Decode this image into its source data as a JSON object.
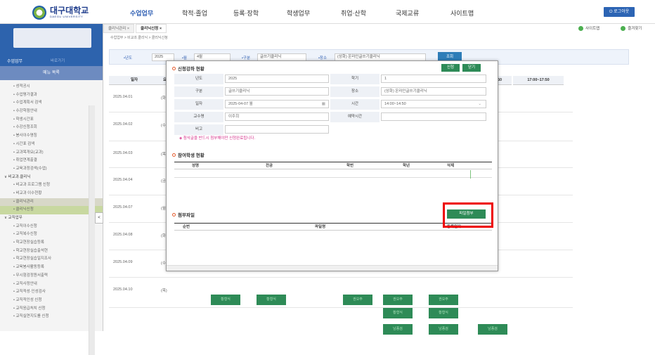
{
  "header": {
    "logo_main": "대구대학교",
    "logo_sub": "DAEGU UNIVERSITY",
    "nav": [
      "수업업무",
      "학적·졸업",
      "등록·장학",
      "학생업무",
      "취업·산학",
      "국제교류",
      "사이트맵"
    ],
    "logout": "로그아웃"
  },
  "sidebar": {
    "section": "수업업무",
    "section_sub": "바로가기",
    "menu_title": "메뉴 목록",
    "items": [
      {
        "label": "• 성적공시",
        "level": 1
      },
      {
        "label": "• 수업평가결과",
        "level": 1
      },
      {
        "label": "• 수업계획서 검색",
        "level": 1
      },
      {
        "label": "• 수강학점안내",
        "level": 1
      },
      {
        "label": "• 학생시간표",
        "level": 1
      },
      {
        "label": "• 수강신청조회",
        "level": 1
      },
      {
        "label": "• 봉사이수명칭",
        "level": 1
      },
      {
        "label": "• 시간표 검색",
        "level": 1
      },
      {
        "label": "• 교과목개요(교과)",
        "level": 1
      },
      {
        "label": "• 취업연계출결",
        "level": 1
      },
      {
        "label": "• 교육과정검색(수업)",
        "level": 1
      },
      {
        "label": "∨ 비교과.클리닉",
        "level": 0
      },
      {
        "label": "• 비교과 프로그램 신청",
        "level": 1
      },
      {
        "label": "• 비교과 이수현황",
        "level": 1
      },
      {
        "label": "• 클리닉관리",
        "level": 1,
        "state": "sel2"
      },
      {
        "label": "• 클리닉신청",
        "level": 1,
        "state": "sel"
      },
      {
        "label": "∨ 교직업무",
        "level": 0
      },
      {
        "label": "• 교직이수신청",
        "level": 1
      },
      {
        "label": "• 교직복수신청",
        "level": 1
      },
      {
        "label": "• 학교현장실습등록",
        "level": 1
      },
      {
        "label": "• 학교현장실습출석현",
        "level": 1
      },
      {
        "label": "• 학교현장실습일지조사",
        "level": 1
      },
      {
        "label": "• 교육봉사활동등록",
        "level": 1
      },
      {
        "label": "• 무시험검정원서출력",
        "level": 1
      },
      {
        "label": "• 교직사정안내",
        "level": 1
      },
      {
        "label": "• 교직적성·인성검사",
        "level": 1
      },
      {
        "label": "• 교직적인성 신청",
        "level": 1
      },
      {
        "label": "• 교직응급처치 신청",
        "level": 1
      },
      {
        "label": "• 교직실연지도를 신청",
        "level": 1
      }
    ],
    "collapse": "<"
  },
  "tabs": [
    {
      "label": "클리닉관리 ×",
      "active": false
    },
    {
      "label": "클리닉신청 ×",
      "active": true
    }
  ],
  "breadcrumb": "수업업무 > 비교과.클리닉 > 클리닉신청",
  "right_links": [
    "사이트맵",
    "즐겨찾기"
  ],
  "filter": {
    "year_label": "•년도",
    "year_value": "2025",
    "month_label": "•월",
    "month_value": "4월",
    "type_label": "•구분",
    "type_value": "글쓰기클리닉",
    "place_label": "•장소",
    "place_value": "(상화) 온라인글쓰기클리닉",
    "search_btn": "조회"
  },
  "grid": {
    "col_date": "일자",
    "col_day": "요일",
    "time_cols": [
      "16:50",
      "17:00~17:50"
    ],
    "rows": [
      {
        "date": "2025.04.01",
        "day": "(화)"
      },
      {
        "date": "2025.04.02",
        "day": "(수)"
      },
      {
        "date": "2025.04.03",
        "day": "(목)"
      },
      {
        "date": "2025.04.04",
        "day": "(금)"
      },
      {
        "date": "2025.04.07",
        "day": "(월)"
      },
      {
        "date": "2025.04.08",
        "day": "(화)"
      },
      {
        "date": "2025.04.09",
        "day": "(수)"
      },
      {
        "date": "2025.04.10",
        "day": "(목)"
      }
    ],
    "slots": [
      "황형식",
      "황형식",
      "권오주",
      "권오주",
      "권오주",
      "황형식",
      "황형식",
      "남종검",
      "남종검",
      "남종검"
    ]
  },
  "modal": {
    "title": "신청강좌 현황",
    "apply_btn": "신청",
    "close_btn": "닫기",
    "fields": {
      "year_label": "년도",
      "year_value": "2025",
      "semester_label": "학기",
      "semester_value": "1",
      "type_label": "구분",
      "type_value": "글쓰기클리닉",
      "place_label": "장소",
      "place_value": "(상화) 온라인글쓰기클리닉",
      "date_label": "일자",
      "date_value": "2025-04-07 월",
      "time_label": "시간",
      "time_value": "14:00~14:50",
      "prof_label": "교수명",
      "prof_value": "이주희",
      "booking_label": "예약시간",
      "booking_value": "",
      "note_label": "비고",
      "note_value": ""
    },
    "notice": "◈ 첨삭글을 반드시 첨부해야만 신청완료됩니다.",
    "participants_title": "참여학생 현황",
    "participants_cols": [
      "성명",
      "전공",
      "학번",
      "학년",
      "삭제"
    ],
    "files_title": "첨부파일",
    "file_attach_btn": "파일첨부",
    "files_cols": [
      "순번",
      "파일명",
      "등록일자"
    ]
  }
}
